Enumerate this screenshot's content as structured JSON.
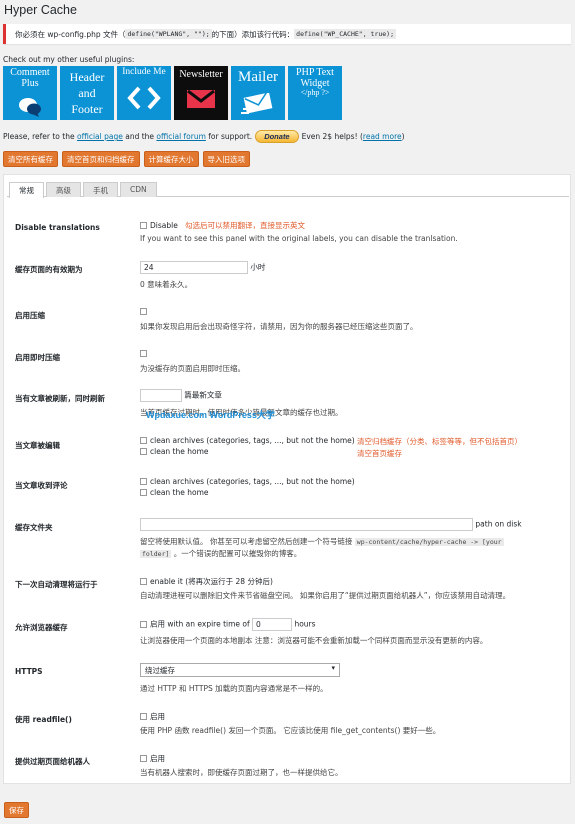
{
  "page": {
    "title": "Hyper Cache"
  },
  "notice": {
    "text_pre": "你必须在 wp-config.php 文件（",
    "code1": "define(\"WPLANG\", \"\");",
    "text_mid": "的下面）添加该行代码：",
    "code2": "define(\"WP_CACHE\", true);"
  },
  "plugins": {
    "label": "Check out my other useful plugins:",
    "items": [
      {
        "name": "Comment Plus",
        "lines": [
          "Comment",
          "Plus"
        ],
        "icon": "speech-bubble-icon",
        "color": "#0c93d6"
      },
      {
        "name": "Header and Footer",
        "lines": [
          "Header",
          "and",
          "Footer"
        ],
        "icon": "",
        "color": "#0c93d6"
      },
      {
        "name": "Include Me",
        "lines": [
          "Include Me"
        ],
        "icon": "code-brackets-icon",
        "color": "#0c93d6"
      },
      {
        "name": "Newsletter",
        "lines": [
          "Newsletter"
        ],
        "icon": "envelope-icon",
        "color": "#0d0d0d"
      },
      {
        "name": "Mailer",
        "lines": [
          "Mailer"
        ],
        "icon": "mail-stack-icon",
        "color": "#0c93d6"
      },
      {
        "name": "PHP Text Widget",
        "lines": [
          "PHP Text",
          "Widget",
          "</php ?>"
        ],
        "icon": "",
        "color": "#0c93d6"
      }
    ]
  },
  "refer": {
    "pre": "Please, refer to the",
    "official_page": "official page",
    "and_the": "and the",
    "official_forum": "official forum",
    "for_support": "for support.",
    "donate": "Donate",
    "even": "Even 2$ helps! (",
    "read_more": "read more",
    "close": ")"
  },
  "actions": [
    "清空所有缓存",
    "清空首页和归档缓存",
    "计算缓存大小",
    "导入旧选项"
  ],
  "tabs": [
    "常规",
    "高级",
    "手机",
    "CDN"
  ],
  "settings": {
    "disable_translations": {
      "label": "Disable translations",
      "option": "Disable",
      "annotation": "勾选后可以禁用翻译，直接显示英文",
      "desc": "If you want to see this panel with the original labels, you can disable the tranlsation."
    },
    "cache_lifetime": {
      "label": "缓存页面的有效期为",
      "value": "24",
      "unit": "小时",
      "desc": "0 意味着永久。"
    },
    "compression": {
      "label": "启用压缩",
      "desc": "如果你发现启用后会出现奇怪字符，请禁用，因为你的服务器已经压缩这些页面了。"
    },
    "on_the_fly": {
      "label": "启用即时压缩",
      "desc": "为没缓存的页面启用即时压缩。"
    },
    "when_post_edited": {
      "label": "当有文章被刷新，同时刷新",
      "value": "",
      "unit": "篇最新文章",
      "desc": "当首页缓存过期时，使用时使多少篇最新文章的缓存也过期。",
      "watermark": "Wpdaxue.com WordPress大学"
    },
    "post_edited_clean": {
      "label": "当文章被编辑",
      "option1": "clean archives (categories, tags, ..., but not the home)",
      "option2": "clean the home",
      "annotation1": "清空归档缓存（分类、标签等等，但不包括首页）",
      "annotation2": "清空首页缓存"
    },
    "comment_clean": {
      "label": "当文章收到评论",
      "option1": "clean archives (categories, tags, ..., but not the home)",
      "option2": "clean the home"
    },
    "cache_folder": {
      "label": "缓存文件夹",
      "value": "",
      "suffix": "path on disk",
      "desc_pre": "留空将使用默认值。 你甚至可以考虑留空然后创建一个符号链接",
      "desc_code": "wp-content/cache/hyper-cache -> [your",
      "desc_code2": "folder]",
      "desc_post": "。一个错误的配置可以摧毁你的博客。"
    },
    "autoclean": {
      "label": "下一次自动清理将运行于",
      "option": "enable it (将再次运行于 28 分钟后)",
      "desc": "自动清理进程可以删除旧文件来节省磁盘空间。 如果你启用了“提供过期页面给机器人”，你应该禁用自动清理。"
    },
    "browser_cache": {
      "label": "允许浏览器缓存",
      "option": "启用 with an expire time of",
      "value": "0",
      "unit": "hours",
      "desc": "让浏览器使用一个页面的本地副本 注意：浏览器可能不会重新加载一个同样页面而显示没有更新的内容。"
    },
    "https": {
      "label": "HTTPS",
      "selected": "绕过缓存",
      "desc": "通过 HTTP 和 HTTPS 加载的页面内容通常是不一样的。"
    },
    "readfile": {
      "label": "使用 readfile()",
      "option": "启用",
      "desc": "使用 PHP 函数 readfile() 发回一个页面。 它应该比使用 file_get_contents() 要好一些。"
    },
    "expired_bots": {
      "label": "提供过期页面给机器人",
      "option": "启用",
      "desc": "当有机器人搜索时，即使缓存页面过期了，也一样提供给它。"
    }
  },
  "save": "保存"
}
